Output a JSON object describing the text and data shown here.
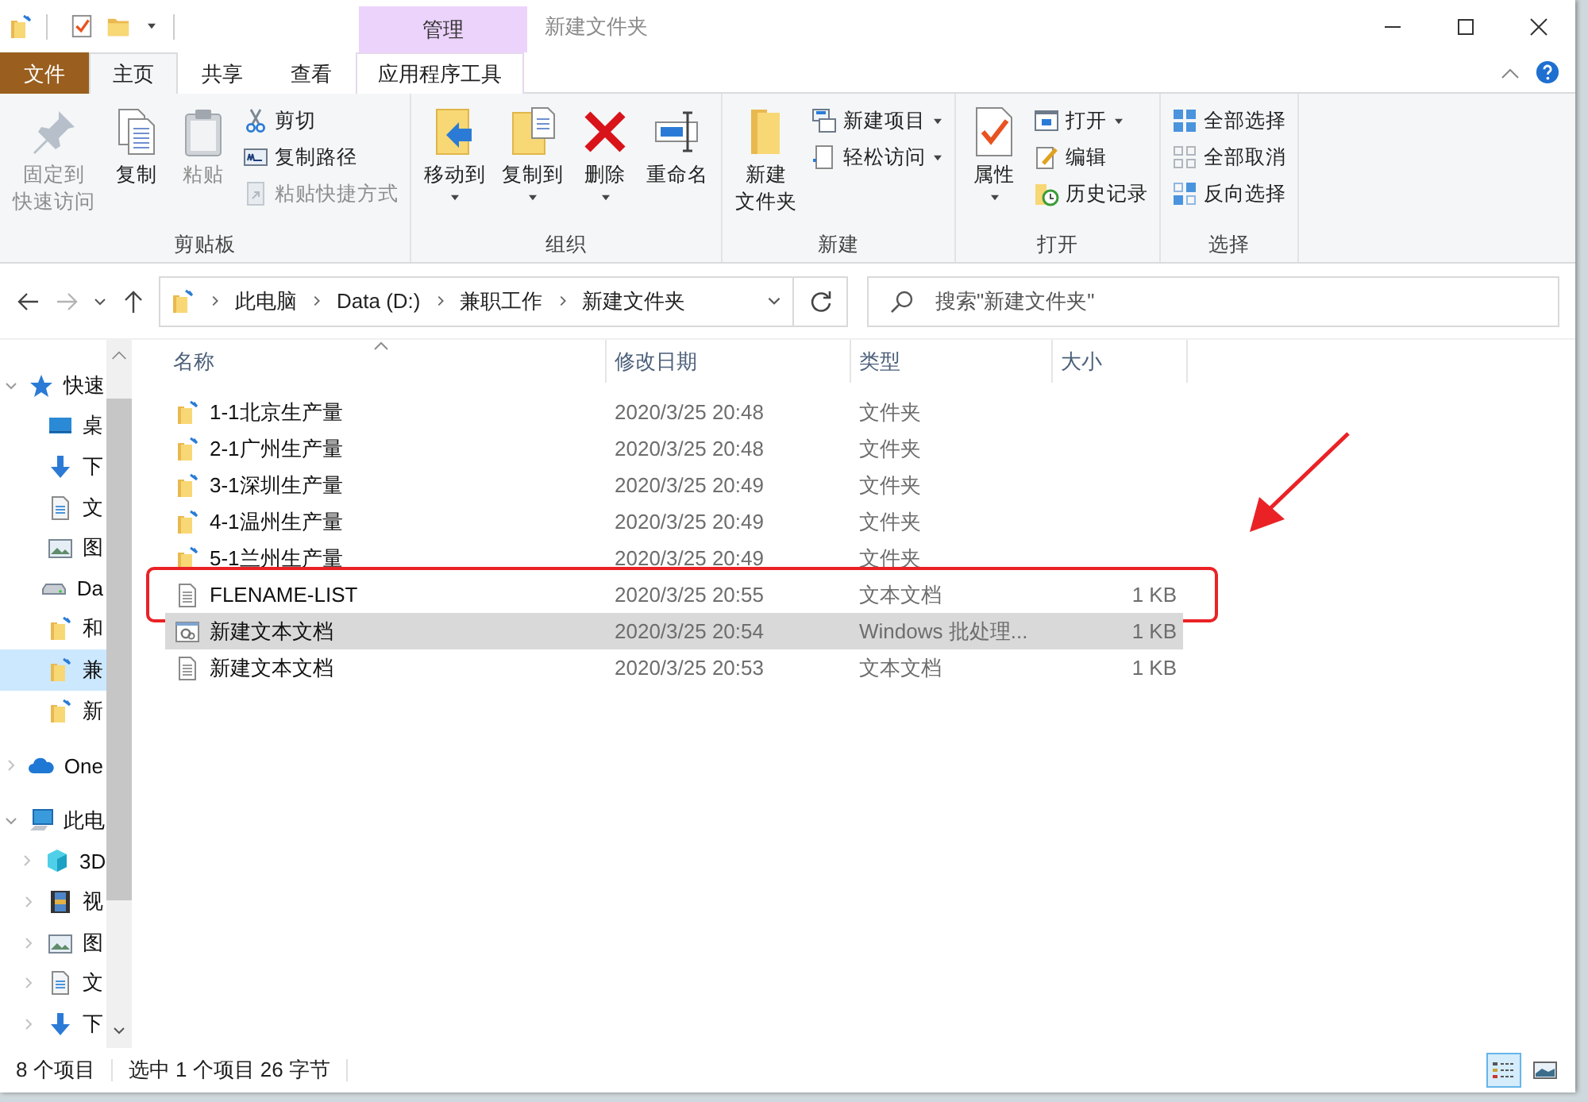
{
  "title_bar": {
    "contextual_tab": "管理",
    "title": "新建文件夹"
  },
  "ribbon_tabs": [
    {
      "label": "文件",
      "kind": "file",
      "selected": false
    },
    {
      "label": "主页",
      "kind": "tab",
      "selected": true
    },
    {
      "label": "共享",
      "kind": "tab",
      "selected": false
    },
    {
      "label": "查看",
      "kind": "tab",
      "selected": false
    },
    {
      "label": "应用程序工具",
      "kind": "contextual",
      "selected": false
    }
  ],
  "ribbon_groups": [
    {
      "label": "剪贴板",
      "items": [
        {
          "label_lines": [
            "固定到",
            "快速访问"
          ],
          "kind": "large",
          "disabled": true,
          "dropdown": false
        },
        {
          "label": "复制",
          "kind": "large",
          "disabled": false,
          "dropdown": false
        },
        {
          "label": "粘贴",
          "kind": "large",
          "disabled": true,
          "dropdown": false
        },
        {
          "label": "剪切",
          "kind": "small",
          "disabled": false,
          "dropdown": false
        },
        {
          "label": "复制路径",
          "kind": "small",
          "disabled": false,
          "dropdown": false
        },
        {
          "label": "粘贴快捷方式",
          "kind": "small",
          "disabled": true,
          "dropdown": false
        }
      ]
    },
    {
      "label": "组织",
      "items": [
        {
          "label": "移动到",
          "kind": "large",
          "disabled": false,
          "dropdown": true
        },
        {
          "label": "复制到",
          "kind": "large",
          "disabled": false,
          "dropdown": true
        },
        {
          "label": "删除",
          "kind": "large",
          "disabled": false,
          "dropdown": true
        },
        {
          "label": "重命名",
          "kind": "large",
          "disabled": false,
          "dropdown": false
        }
      ]
    },
    {
      "label": "新建",
      "items": [
        {
          "label_lines": [
            "新建",
            "文件夹"
          ],
          "kind": "large",
          "disabled": false,
          "dropdown": false
        },
        {
          "label": "新建项目",
          "kind": "small",
          "disabled": false,
          "dropdown": true
        },
        {
          "label": "轻松访问",
          "kind": "small",
          "disabled": false,
          "dropdown": true
        }
      ]
    },
    {
      "label": "打开",
      "items": [
        {
          "label": "属性",
          "kind": "large",
          "disabled": false,
          "dropdown": true
        },
        {
          "label": "打开",
          "kind": "small",
          "disabled": false,
          "dropdown": true
        },
        {
          "label": "编辑",
          "kind": "small",
          "disabled": false,
          "dropdown": false
        },
        {
          "label": "历史记录",
          "kind": "small",
          "disabled": false,
          "dropdown": false
        }
      ]
    },
    {
      "label": "选择",
      "items": [
        {
          "label": "全部选择",
          "kind": "small",
          "disabled": false,
          "dropdown": false
        },
        {
          "label": "全部取消",
          "kind": "small",
          "disabled": false,
          "dropdown": false
        },
        {
          "label": "反向选择",
          "kind": "small",
          "disabled": false,
          "dropdown": false
        }
      ]
    }
  ],
  "address_bar": {
    "path": [
      "此电脑",
      "Data (D:)",
      "兼职工作",
      "新建文件夹"
    ]
  },
  "search": {
    "placeholder": "搜索\"新建文件夹\""
  },
  "nav_pane": [
    {
      "label": "快速",
      "kind": "star",
      "expanded": true,
      "selected": false,
      "children": [
        {
          "label": "桌",
          "kind": "desktop",
          "selected": false
        },
        {
          "label": "下",
          "kind": "download",
          "selected": false
        },
        {
          "label": "文",
          "kind": "document",
          "selected": false
        },
        {
          "label": "图",
          "kind": "pictures",
          "selected": false
        },
        {
          "label": "Da",
          "kind": "drive",
          "selected": false
        },
        {
          "label": "和",
          "kind": "folder",
          "selected": false
        },
        {
          "label": "兼",
          "kind": "folder",
          "selected": true
        },
        {
          "label": "新",
          "kind": "folder",
          "selected": false
        }
      ]
    },
    {
      "label": "One",
      "kind": "cloud",
      "expanded": false,
      "selected": false
    },
    {
      "label": "此电",
      "kind": "computer",
      "expanded": true,
      "selected": false,
      "children": [
        {
          "label": "3D",
          "kind": "cube",
          "expanded": false,
          "selected": false
        },
        {
          "label": "视",
          "kind": "video",
          "expanded": false,
          "selected": false
        },
        {
          "label": "图",
          "kind": "pictures",
          "expanded": false,
          "selected": false
        },
        {
          "label": "文",
          "kind": "document",
          "expanded": false,
          "selected": false
        },
        {
          "label": "下",
          "kind": "download",
          "expanded": false,
          "selected": false
        }
      ]
    }
  ],
  "file_list": {
    "columns": [
      "名称",
      "修改日期",
      "类型",
      "大小"
    ],
    "rows": [
      {
        "kind": "folder",
        "name": "1-1北京生产量",
        "modified": "2020/3/25 20:48",
        "type": "文件夹",
        "selected": false,
        "highlighted": false
      },
      {
        "kind": "folder",
        "name": "2-1广州生产量",
        "modified": "2020/3/25 20:48",
        "type": "文件夹",
        "selected": false,
        "highlighted": false
      },
      {
        "kind": "folder",
        "name": "3-1深圳生产量",
        "modified": "2020/3/25 20:49",
        "type": "文件夹",
        "selected": false,
        "highlighted": false
      },
      {
        "kind": "folder",
        "name": "4-1温州生产量",
        "modified": "2020/3/25 20:49",
        "type": "文件夹",
        "selected": false,
        "highlighted": false
      },
      {
        "kind": "folder",
        "name": "5-1兰州生产量",
        "modified": "2020/3/25 20:49",
        "type": "文件夹",
        "selected": false,
        "highlighted": false
      },
      {
        "kind": "text",
        "name": "FLENAME-LIST",
        "modified": "2020/3/25 20:55",
        "type": "文本文档",
        "size": "1 KB",
        "selected": false,
        "highlighted": true
      },
      {
        "kind": "batch",
        "name": "新建文本文档",
        "modified": "2020/3/25 20:54",
        "type": "Windows 批处理...",
        "size": "1 KB",
        "selected": true,
        "highlighted": false
      },
      {
        "kind": "text",
        "name": "新建文本文档",
        "modified": "2020/3/25 20:53",
        "type": "文本文档",
        "size": "1 KB",
        "selected": false,
        "highlighted": false
      }
    ]
  },
  "status_bar": {
    "item_count": "8 个项目",
    "selection": "选中 1 个项目  26 字节"
  },
  "view_buttons": [
    {
      "kind": "details",
      "selected": true
    },
    {
      "kind": "large_icons",
      "selected": false
    }
  ]
}
